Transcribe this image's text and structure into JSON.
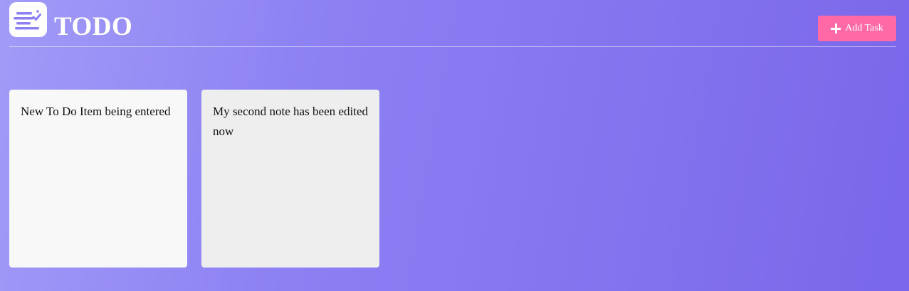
{
  "app": {
    "title": "TODO",
    "logo_icon": "todo-list-icon"
  },
  "toolbar": {
    "add_task_label": "Add Task",
    "add_task_icon": "plus-icon",
    "add_task_color": "#ff69a6"
  },
  "notes": [
    {
      "text": "New To Do Item being entered"
    },
    {
      "text": "My second note has been edited now"
    }
  ],
  "colors": {
    "background_start": "#a29bf7",
    "background_end": "#7966e9",
    "accent": "#8c80f3"
  }
}
